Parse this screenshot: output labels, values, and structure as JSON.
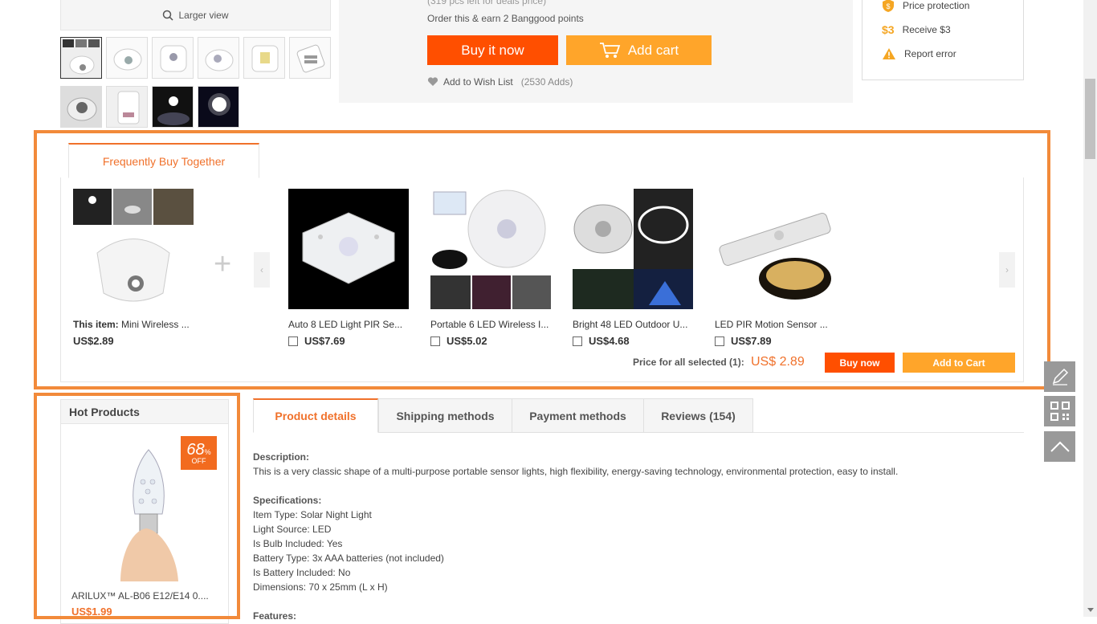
{
  "gallery": {
    "larger_view_label": "Larger view"
  },
  "purchase": {
    "stock_note": "(319 pcs left for deals price)",
    "points_note": "Order this & earn 2 Banggood points",
    "buy_now_label": "Buy it now",
    "add_cart_label": "Add cart",
    "wishlist_label": "Add to Wish List",
    "wishlist_count": "(2530 Adds)"
  },
  "side_services": [
    {
      "icon": "shield-dollar-icon",
      "label": "Price protection"
    },
    {
      "icon": "dollar-3-icon",
      "label": "Receive $3",
      "icon_text": "$3"
    },
    {
      "icon": "warning-icon",
      "label": "Report error"
    }
  ],
  "fbt": {
    "tab_label": "Frequently Buy Together",
    "this_item_prefix": "This item:",
    "this_item_name": "Mini Wireless ...",
    "this_item_price": "US$2.89",
    "items": [
      {
        "name": "Auto 8 LED Light PIR Se...",
        "price": "US$7.69"
      },
      {
        "name": "Portable 6 LED Wireless I...",
        "price": "US$5.02"
      },
      {
        "name": "Bright 48 LED Outdoor U...",
        "price": "US$4.68"
      },
      {
        "name": "LED PIR Motion Sensor ...",
        "price": "US$7.89"
      }
    ],
    "total_label": "Price for all selected (1):",
    "total_price": "US$ 2.89",
    "buy_now_label": "Buy now",
    "add_to_cart_label": "Add to Cart"
  },
  "hot": {
    "title": "Hot Products",
    "discount_num": "68",
    "discount_pct": "%",
    "discount_off": "OFF",
    "product_name": "ARILUX™ AL-B06 E12/E14 0....",
    "price": "US$1.99"
  },
  "tabs": [
    {
      "label": "Product details",
      "active": true
    },
    {
      "label": "Shipping methods"
    },
    {
      "label": "Payment methods"
    },
    {
      "label": "Reviews (154)"
    }
  ],
  "details": {
    "desc_heading": "Description:",
    "desc_text": "This is a very classic shape of a multi-purpose portable sensor lights, high flexibility, energy-saving technology, environmental protection, easy to install.",
    "spec_heading": "Specifications:",
    "specs": [
      "Item Type: Solar Night Light",
      "Light Source: LED",
      "Is Bulb Included: Yes",
      "Battery Type: 3x AAA batteries (not included)",
      "Is Battery Included: No",
      "Dimensions: 70 x 25mm (L x H)"
    ],
    "features_heading": "Features:"
  },
  "colors": {
    "accent": "#f0712b",
    "buy": "#ff4f00",
    "cart": "#ffa52a",
    "highlight": "#f28a3a"
  }
}
